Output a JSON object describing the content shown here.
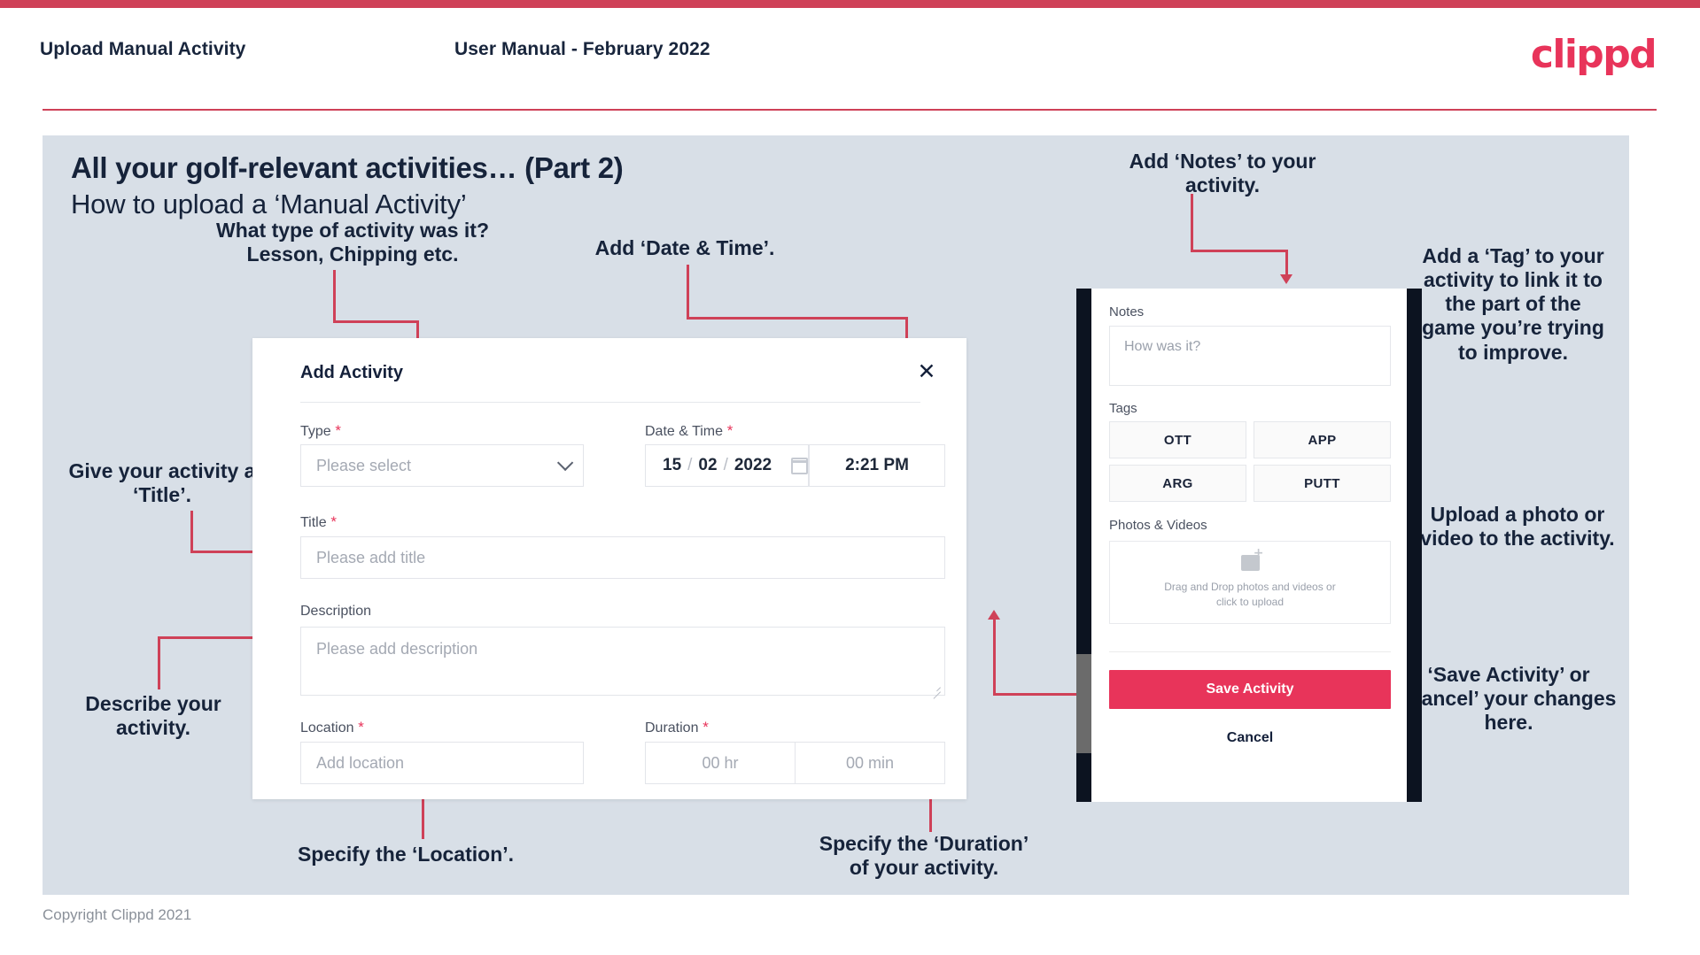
{
  "header": {
    "left_title": "Upload Manual Activity",
    "center_title": "User Manual - February 2022",
    "logo": "clippd"
  },
  "slide": {
    "title": "All your golf-relevant activities… (Part 2)",
    "subtitle": "How to upload a ‘Manual Activity’"
  },
  "annotations": {
    "type": "What type of activity was it?\nLesson, Chipping etc.",
    "datetime": "Add ‘Date & Time’.",
    "title": "Give your activity a\n‘Title’.",
    "description": "Describe your\nactivity.",
    "location": "Specify the ‘Location’.",
    "duration": "Specify the ‘Duration’\nof your activity.",
    "notes": "Add ‘Notes’ to your\nactivity.",
    "tags": "Add a ‘Tag’ to your\nactivity to link it to\nthe part of the\ngame you’re trying\nto improve.",
    "photos": "Upload a photo or\nvideo to the activity.",
    "save_cancel": "‘Save Activity’ or\n‘Cancel’ your changes\nhere."
  },
  "dialog": {
    "title": "Add Activity",
    "close_icon": "close-icon",
    "fields": {
      "type": {
        "label": "Type",
        "required": true,
        "placeholder": "Please select",
        "value": ""
      },
      "datetime": {
        "label": "Date & Time",
        "required": true,
        "day": "15",
        "month": "02",
        "year": "2022",
        "separator": "/",
        "calendar_icon": "calendar-icon",
        "time": "2:21 PM"
      },
      "title": {
        "label": "Title",
        "required": true,
        "placeholder": "Please add title",
        "value": ""
      },
      "description": {
        "label": "Description",
        "required": false,
        "placeholder": "Please add description",
        "value": ""
      },
      "location": {
        "label": "Location",
        "required": true,
        "placeholder": "Add location",
        "value": ""
      },
      "duration": {
        "label": "Duration",
        "required": true,
        "hours_placeholder": "00 hr",
        "minutes_placeholder": "00 min"
      }
    }
  },
  "phone": {
    "notes": {
      "label": "Notes",
      "placeholder": "How was it?",
      "value": ""
    },
    "tags": {
      "label": "Tags",
      "items": [
        "OTT",
        "APP",
        "ARG",
        "PUTT"
      ]
    },
    "photos": {
      "label": "Photos & Videos",
      "dropzone_icon": "add-image-icon",
      "dropzone_text": "Drag and Drop photos and videos or\nclick to upload"
    },
    "save_label": "Save Activity",
    "cancel_label": "Cancel"
  },
  "footer": {
    "copyright": "Copyright Clippd 2021"
  },
  "colors": {
    "accent": "#e8345a",
    "bar": "#cf4158",
    "slide_bg": "#d8dfe7",
    "text_dark": "#16233a"
  }
}
